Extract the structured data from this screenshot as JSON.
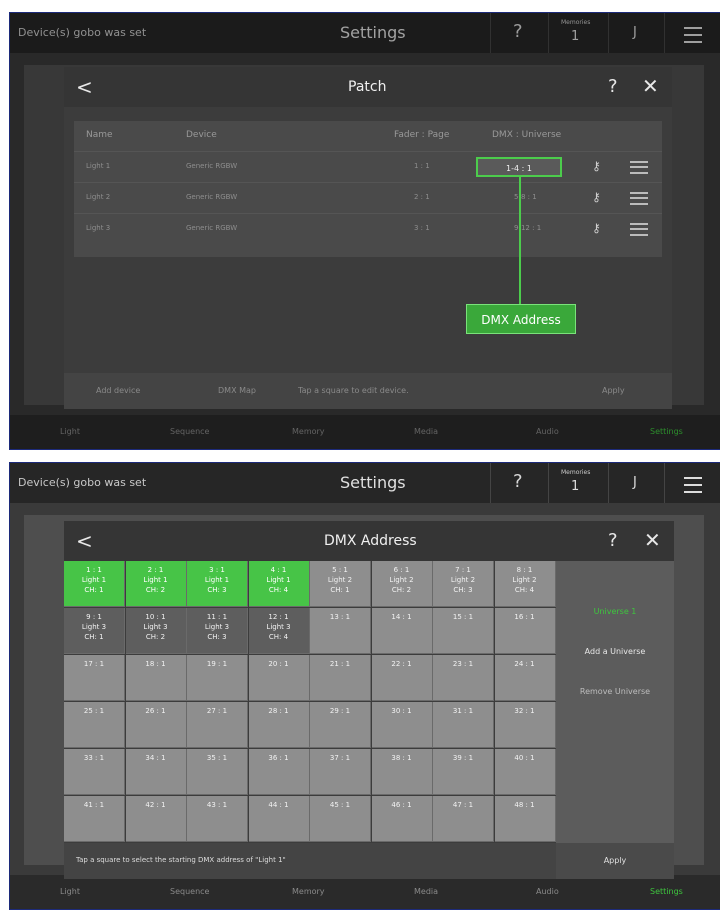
{
  "topbar": {
    "message": "Device(s) gobo was set",
    "title": "Settings",
    "help": "?",
    "memories_label": "Memories",
    "memories_value": "1",
    "user_initial": "J"
  },
  "bottom_nav": [
    "Light",
    "Sequence",
    "Memory",
    "Media",
    "Audio",
    "Settings"
  ],
  "patch": {
    "title": "Patch",
    "back": "<",
    "help": "?",
    "close": "✕",
    "columns": [
      "Name",
      "Device",
      "Fader : Page",
      "DMX : Universe"
    ],
    "rows": [
      {
        "name": "Light 1",
        "device": "Generic RGBW",
        "fader": "1 : 1",
        "dmx": "1-4 : 1"
      },
      {
        "name": "Light 2",
        "device": "Generic RGBW",
        "fader": "2 : 1",
        "dmx": "5-8 : 1"
      },
      {
        "name": "Light 3",
        "device": "Generic RGBW",
        "fader": "3 : 1",
        "dmx": "9-12 : 1"
      }
    ],
    "callout": "DMX Address",
    "footer": {
      "add_device": "Add device",
      "dmx_map": "DMX Map",
      "hint": "Tap a square to edit device.",
      "apply": "Apply"
    }
  },
  "dmx_dialog": {
    "title": "DMX Address",
    "back": "<",
    "help": "?",
    "close": "✕",
    "universe_selected": "Universe 1",
    "add_universe": "Add a Universe",
    "remove_universe": "Remove Universe",
    "hint": "Tap a square to select the starting DMX address of \"Light 1\"",
    "apply": "Apply",
    "colors": {
      "assigned_selected": "#47c447",
      "assigned_other": "#5e5e5e",
      "free": "#8e8e8e",
      "accent": "#3ec53e"
    },
    "cells": [
      {
        "addr": "1 : 1",
        "light": "Light 1",
        "ch": "CH: 1",
        "state": "green"
      },
      {
        "addr": "2 : 1",
        "light": "Light 1",
        "ch": "CH: 2",
        "state": "green"
      },
      {
        "addr": "3 : 1",
        "light": "Light 1",
        "ch": "CH: 3",
        "state": "green"
      },
      {
        "addr": "4 : 1",
        "light": "Light 1",
        "ch": "CH: 4",
        "state": "green"
      },
      {
        "addr": "5 : 1",
        "light": "Light 2",
        "ch": "CH: 1",
        "state": "free"
      },
      {
        "addr": "6 : 1",
        "light": "Light 2",
        "ch": "CH: 2",
        "state": "free"
      },
      {
        "addr": "7 : 1",
        "light": "Light 2",
        "ch": "CH: 3",
        "state": "free"
      },
      {
        "addr": "8 : 1",
        "light": "Light 2",
        "ch": "CH: 4",
        "state": "free"
      },
      {
        "addr": "9 : 1",
        "light": "Light 3",
        "ch": "CH: 1",
        "state": "dark"
      },
      {
        "addr": "10 : 1",
        "light": "Light 3",
        "ch": "CH: 2",
        "state": "dark"
      },
      {
        "addr": "11 : 1",
        "light": "Light 3",
        "ch": "CH: 3",
        "state": "dark"
      },
      {
        "addr": "12 : 1",
        "light": "Light 3",
        "ch": "CH: 4",
        "state": "dark"
      },
      {
        "addr": "13 : 1"
      },
      {
        "addr": "14 : 1"
      },
      {
        "addr": "15 : 1"
      },
      {
        "addr": "16 : 1"
      },
      {
        "addr": "17 : 1"
      },
      {
        "addr": "18 : 1"
      },
      {
        "addr": "19 : 1"
      },
      {
        "addr": "20 : 1"
      },
      {
        "addr": "21 : 1"
      },
      {
        "addr": "22 : 1"
      },
      {
        "addr": "23 : 1"
      },
      {
        "addr": "24 : 1"
      },
      {
        "addr": "25 : 1"
      },
      {
        "addr": "26 : 1"
      },
      {
        "addr": "27 : 1"
      },
      {
        "addr": "28 : 1"
      },
      {
        "addr": "29 : 1"
      },
      {
        "addr": "30 : 1"
      },
      {
        "addr": "31 : 1"
      },
      {
        "addr": "32 : 1"
      },
      {
        "addr": "33 : 1"
      },
      {
        "addr": "34 : 1"
      },
      {
        "addr": "35 : 1"
      },
      {
        "addr": "36 : 1"
      },
      {
        "addr": "37 : 1"
      },
      {
        "addr": "38 : 1"
      },
      {
        "addr": "39 : 1"
      },
      {
        "addr": "40 : 1"
      },
      {
        "addr": "41 : 1"
      },
      {
        "addr": "42 : 1"
      },
      {
        "addr": "43 : 1"
      },
      {
        "addr": "44 : 1"
      },
      {
        "addr": "45 : 1"
      },
      {
        "addr": "46 : 1"
      },
      {
        "addr": "47 : 1"
      },
      {
        "addr": "48 : 1"
      }
    ]
  }
}
